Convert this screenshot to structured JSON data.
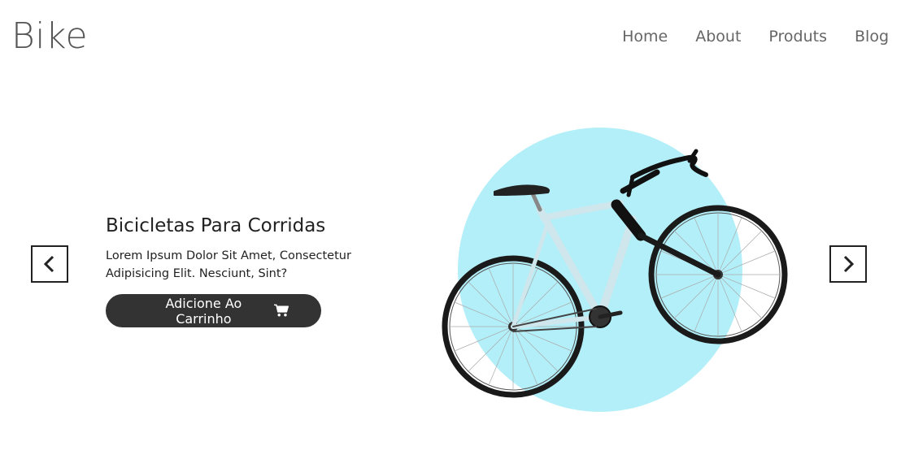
{
  "header": {
    "logo": "Bike",
    "nav": [
      "Home",
      "About",
      "Produts",
      "Blog"
    ]
  },
  "slide": {
    "title": "Bicicletas Para Corridas",
    "description": "Lorem Ipsum Dolor Sit Amet, Consectetur Adipisicing Elit. Nesciunt, Sint?",
    "button_label": "Adicione Ao Carrinho"
  },
  "icons": {
    "prev": "chevron-left-icon",
    "next": "chevron-right-icon",
    "cart": "shopping-cart-icon"
  },
  "colors": {
    "circle": "#b3eff8",
    "button": "#333333",
    "frame": "#cfe6ec"
  }
}
